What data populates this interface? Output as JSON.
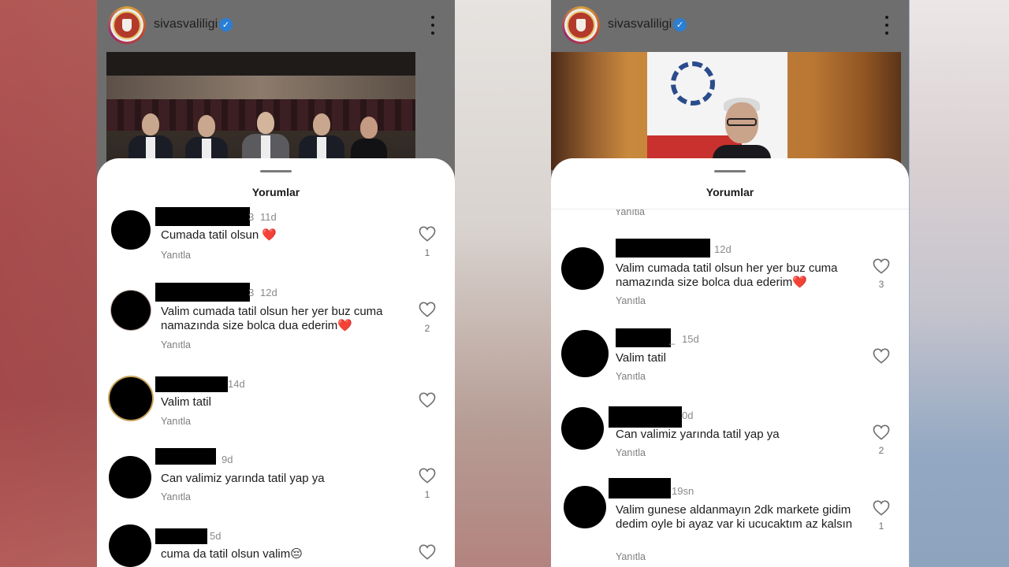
{
  "account": {
    "username": "sivasvaliligi"
  },
  "sheet": {
    "title": "Yorumlar",
    "reply_label": "Yanıtla"
  },
  "icons": {
    "verified": "verified-badge-icon",
    "menu": "kebab-menu-icon",
    "like": "heart-outline-icon"
  },
  "colors": {
    "verified": "#2a7ed3",
    "heart_emoji": "#e0352b"
  },
  "left_panel": {
    "comments": [
      {
        "name_tail": "3",
        "time": "11d",
        "text": "Cumada tatil olsun ",
        "emoji": "❤️",
        "likes": "1"
      },
      {
        "name_tail": "3",
        "time": "12d",
        "text": "Valim cumada tatil olsun her yer buz cuma namazında size bolca dua ederim",
        "emoji": "❤️",
        "likes": "2"
      },
      {
        "name_tail": "",
        "time": "14d",
        "text": "Valim tatil",
        "emoji": "",
        "likes": ""
      },
      {
        "name_tail": "",
        "time": "9d",
        "text": "Can valimiz yarında tatil yap ya",
        "emoji": "",
        "likes": "1"
      },
      {
        "name_tail": "",
        "time": "5d",
        "text": "cuma da tatil olsun valim",
        "emoji": "😔",
        "likes": ""
      }
    ]
  },
  "right_panel": {
    "comments": [
      {
        "name_tail": "",
        "time": "12d",
        "text": "Valim cumada tatil olsun her yer buz cuma namazında size bolca dua ederim",
        "emoji": "❤️",
        "likes": "3"
      },
      {
        "name_tail": "_",
        "time": "15d",
        "text": "Valim tatil",
        "emoji": "",
        "likes": ""
      },
      {
        "name_tail": "",
        "time": "0d",
        "text": "Can valimiz yarında tatil yap ya",
        "emoji": "",
        "likes": "2"
      },
      {
        "name_tail": "",
        "time": "19sn",
        "text": "Valim gunese aldanmayın 2dk markete gidim dedim oyle bi ayaz var ki ucucaktım az kalsın",
        "emoji": "",
        "likes": "1"
      }
    ]
  }
}
